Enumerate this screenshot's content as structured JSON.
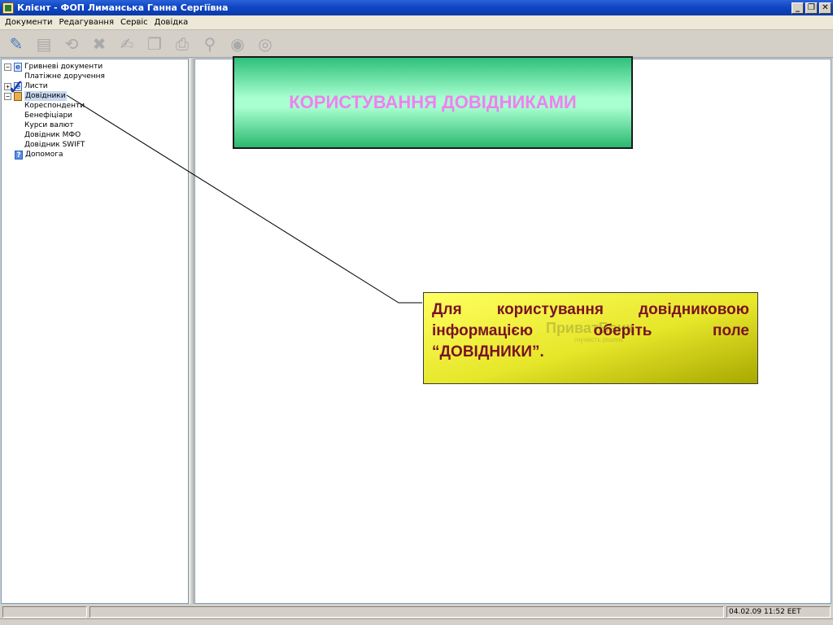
{
  "window": {
    "title": "Клієнт - ФОП Лиманська Ганна Сергіївна",
    "controls": [
      "_",
      "❐",
      "✕"
    ]
  },
  "menu": [
    "Документи",
    "Редагування",
    "Сервіс",
    "Довідка"
  ],
  "toolbar": {
    "buttons": [
      "edit-icon",
      "document-icon",
      "refresh-icon",
      "delete-icon",
      "sign-icon",
      "copy-icon",
      "print-icon",
      "search-icon",
      "send-icon",
      "receive-icon"
    ]
  },
  "tree": {
    "items": [
      {
        "label": "Гривневі документи",
        "level": 0,
        "expander": "−",
        "icon": "doc"
      },
      {
        "label": "Платіжне доручення",
        "level": 1
      },
      {
        "label": "Листи",
        "level": 0,
        "expander": "+",
        "icon": "doc"
      },
      {
        "label": "Довідники",
        "level": 0,
        "expander": "−",
        "icon": "book",
        "selected": true
      },
      {
        "label": "Кореспонденти",
        "level": 1
      },
      {
        "label": "Бенефіціари",
        "level": 1
      },
      {
        "label": "Курси валют",
        "level": 1
      },
      {
        "label": "Довідник МФО",
        "level": 1
      },
      {
        "label": "Довідник SWIFT",
        "level": 1
      },
      {
        "label": "Допомога",
        "level": 0,
        "icon": "help"
      }
    ]
  },
  "banner": {
    "text": "КОРИСТУВАННЯ ДОВІДНИКАМИ"
  },
  "callout": {
    "text": "Для користування довідниковою інформацією оберіть поле “ДОВІДНИКИ”.",
    "watermark": "ПриватБанк",
    "watermark_sub": "гнучкість рішень"
  },
  "status": {
    "datetime": "04.02.09 11:52 EET"
  },
  "colors": {
    "titlebar": "#0f46c4",
    "banner_text": "#f080f0",
    "callout_text": "#7a1224",
    "callout_bg": "#e6e62a"
  }
}
